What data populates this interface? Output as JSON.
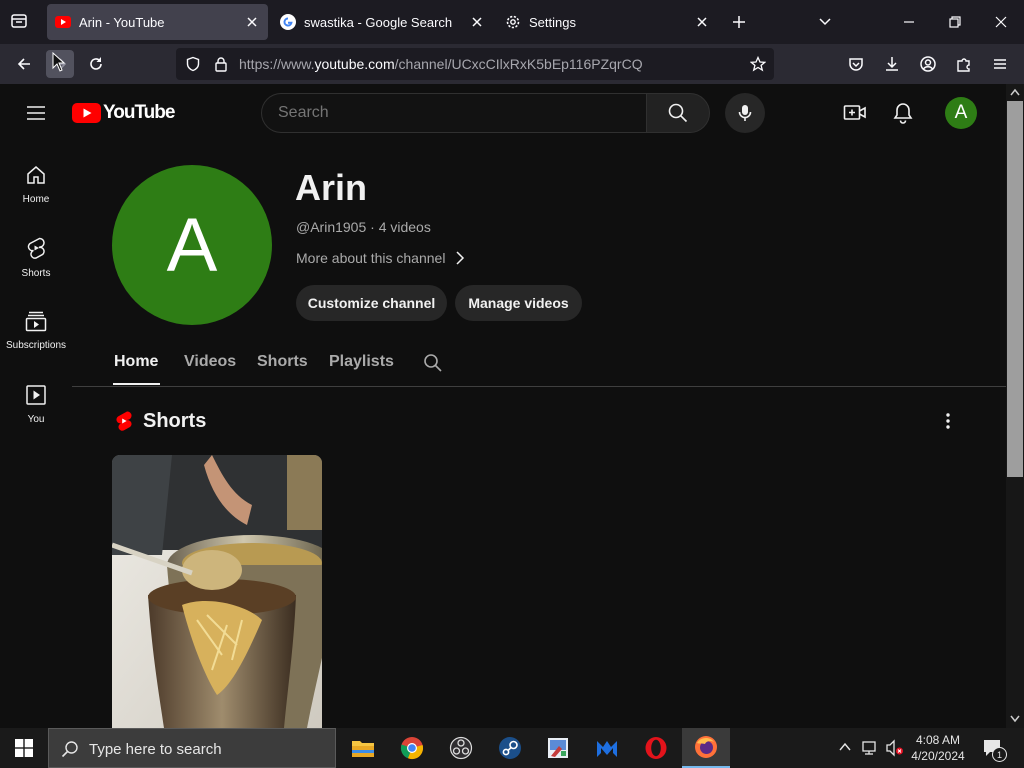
{
  "browser": {
    "tabs": [
      {
        "title": "Arin - YouTube",
        "active": true,
        "icon": "youtube-favicon"
      },
      {
        "title": "swastika - Google Search",
        "active": false,
        "icon": "google-favicon"
      },
      {
        "title": "Settings",
        "active": false,
        "icon": "gear-icon"
      }
    ],
    "url": {
      "prefix": "https://www.",
      "host": "youtube.com",
      "path": "/channel/UCxcCIlxRxK5bEp116PZqrCQ"
    }
  },
  "youtube": {
    "logo_text": "YouTube",
    "search_placeholder": "Search",
    "account_initial": "A",
    "guide": [
      {
        "label": "Home",
        "icon": "home-icon"
      },
      {
        "label": "Shorts",
        "icon": "shorts-icon"
      },
      {
        "label": "Subscriptions",
        "icon": "subscriptions-icon"
      },
      {
        "label": "You",
        "icon": "you-icon"
      }
    ],
    "channel": {
      "avatar_letter": "A",
      "name": "Arin",
      "meta": "@Arin1905 · 4 videos",
      "more_about": "More about this channel",
      "customize_label": "Customize channel",
      "manage_label": "Manage videos"
    },
    "tabs": [
      "Home",
      "Videos",
      "Shorts",
      "Playlists"
    ],
    "selected_tab": "Home",
    "section_title": "Shorts"
  },
  "taskbar": {
    "search_placeholder": "Type here to search",
    "time": "4:08 AM",
    "date": "4/20/2024",
    "notification_count": "1"
  },
  "colors": {
    "youtube_red": "#ff0000",
    "avatar_green": "#2e7d15",
    "accent": "#76b9ed"
  }
}
